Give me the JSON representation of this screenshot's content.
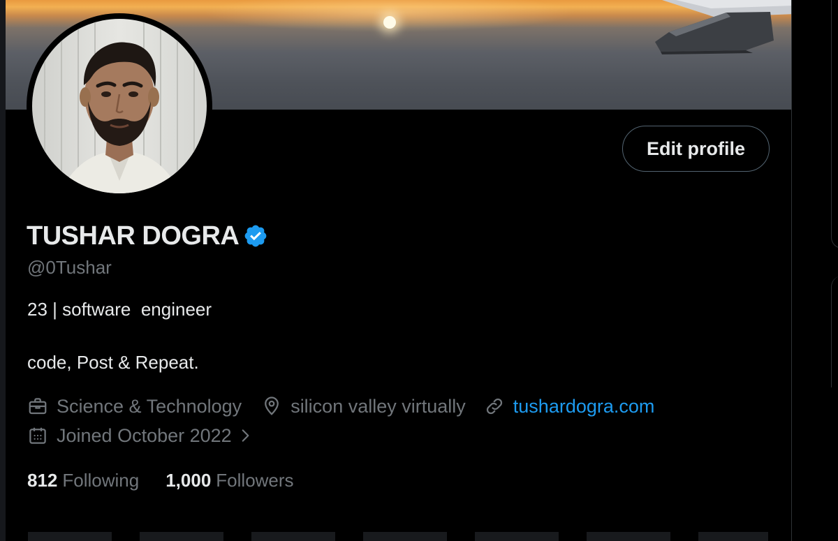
{
  "profile": {
    "name": "TUSHAR DOGRA",
    "handle": "@0Tushar",
    "verified": true,
    "bio_line_1": "23 | software  engineer",
    "bio_line_2": "code, Post & Repeat.",
    "category": "Science & Technology",
    "location": "silicon valley virtually",
    "website": "tushardogra.com",
    "joined": "Joined October 2022",
    "following_count": "812",
    "following_label": "Following",
    "followers_count": "1,000",
    "followers_label": "Followers"
  },
  "actions": {
    "edit_profile_label": "Edit profile"
  },
  "icons": {
    "verified": "verified-badge-icon",
    "category": "briefcase-icon",
    "location": "location-pin-icon",
    "website": "link-icon",
    "joined": "calendar-icon",
    "joined_more": "chevron-right-icon"
  },
  "colors": {
    "background": "#000000",
    "primary_text": "#e7e9ea",
    "secondary_text": "#71767b",
    "link": "#1d9bf0",
    "verified_badge": "#1d9bf0",
    "button_border": "#536471"
  }
}
